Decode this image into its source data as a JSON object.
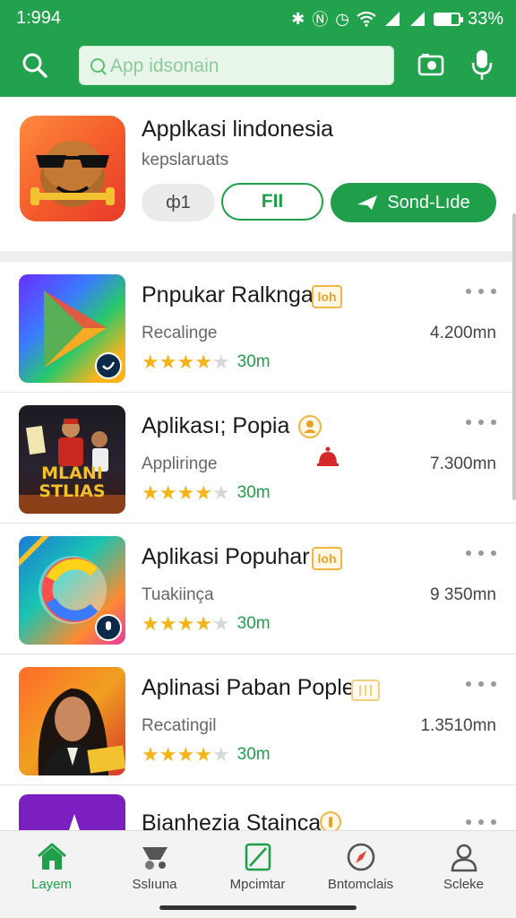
{
  "status_bar": {
    "time": "1:994",
    "battery": "33%"
  },
  "search": {
    "placeholder": "App idsonain"
  },
  "featured": {
    "title": "Applkasi lindonesia",
    "subtitle": "kepslaruats",
    "small_button_label": "ф1",
    "outline_button_label": "FII",
    "primary_button_label": "Sond-Lıde"
  },
  "apps": [
    {
      "title": "Pnpukar Ralkngа",
      "badge": "loh",
      "category": "Recalinge",
      "size": "4.200mn",
      "rating_label": "30m",
      "rating": 4
    },
    {
      "title": "Aplikası; Popia",
      "badge": "",
      "category": "Appliringe",
      "size": "7.300mn",
      "rating_label": "30m",
      "rating": 4
    },
    {
      "title": "Aplikasi Popuhar",
      "badge": "loh",
      "category": "Tuakiinça",
      "size": "9 350mn",
      "rating_label": "30m",
      "rating": 4
    },
    {
      "title": "Aplinasi Paban Pople",
      "badge": "",
      "category": "Recatingil",
      "size": "1.3510mn",
      "rating_label": "30m",
      "rating": 4
    },
    {
      "title": "Bianhezia Staincа",
      "badge": "",
      "category": "",
      "size": "",
      "rating_label": "",
      "rating": 0
    }
  ],
  "icon_texts": {
    "movie_line1": "MLANI",
    "movie_line2": "STLIAS"
  },
  "nav": [
    {
      "label": "Layem",
      "icon": "home-icon"
    },
    {
      "label": "Sslıuna",
      "icon": "games-icon"
    },
    {
      "label": "Mpcimtar",
      "icon": "edit-icon"
    },
    {
      "label": "Bntomclais",
      "icon": "compass-icon"
    },
    {
      "label": "Scleke",
      "icon": "profile-icon"
    }
  ],
  "colors": {
    "primary": "#22a24c",
    "accent_star": "#f3b31a",
    "badge": "#e8a22c"
  }
}
